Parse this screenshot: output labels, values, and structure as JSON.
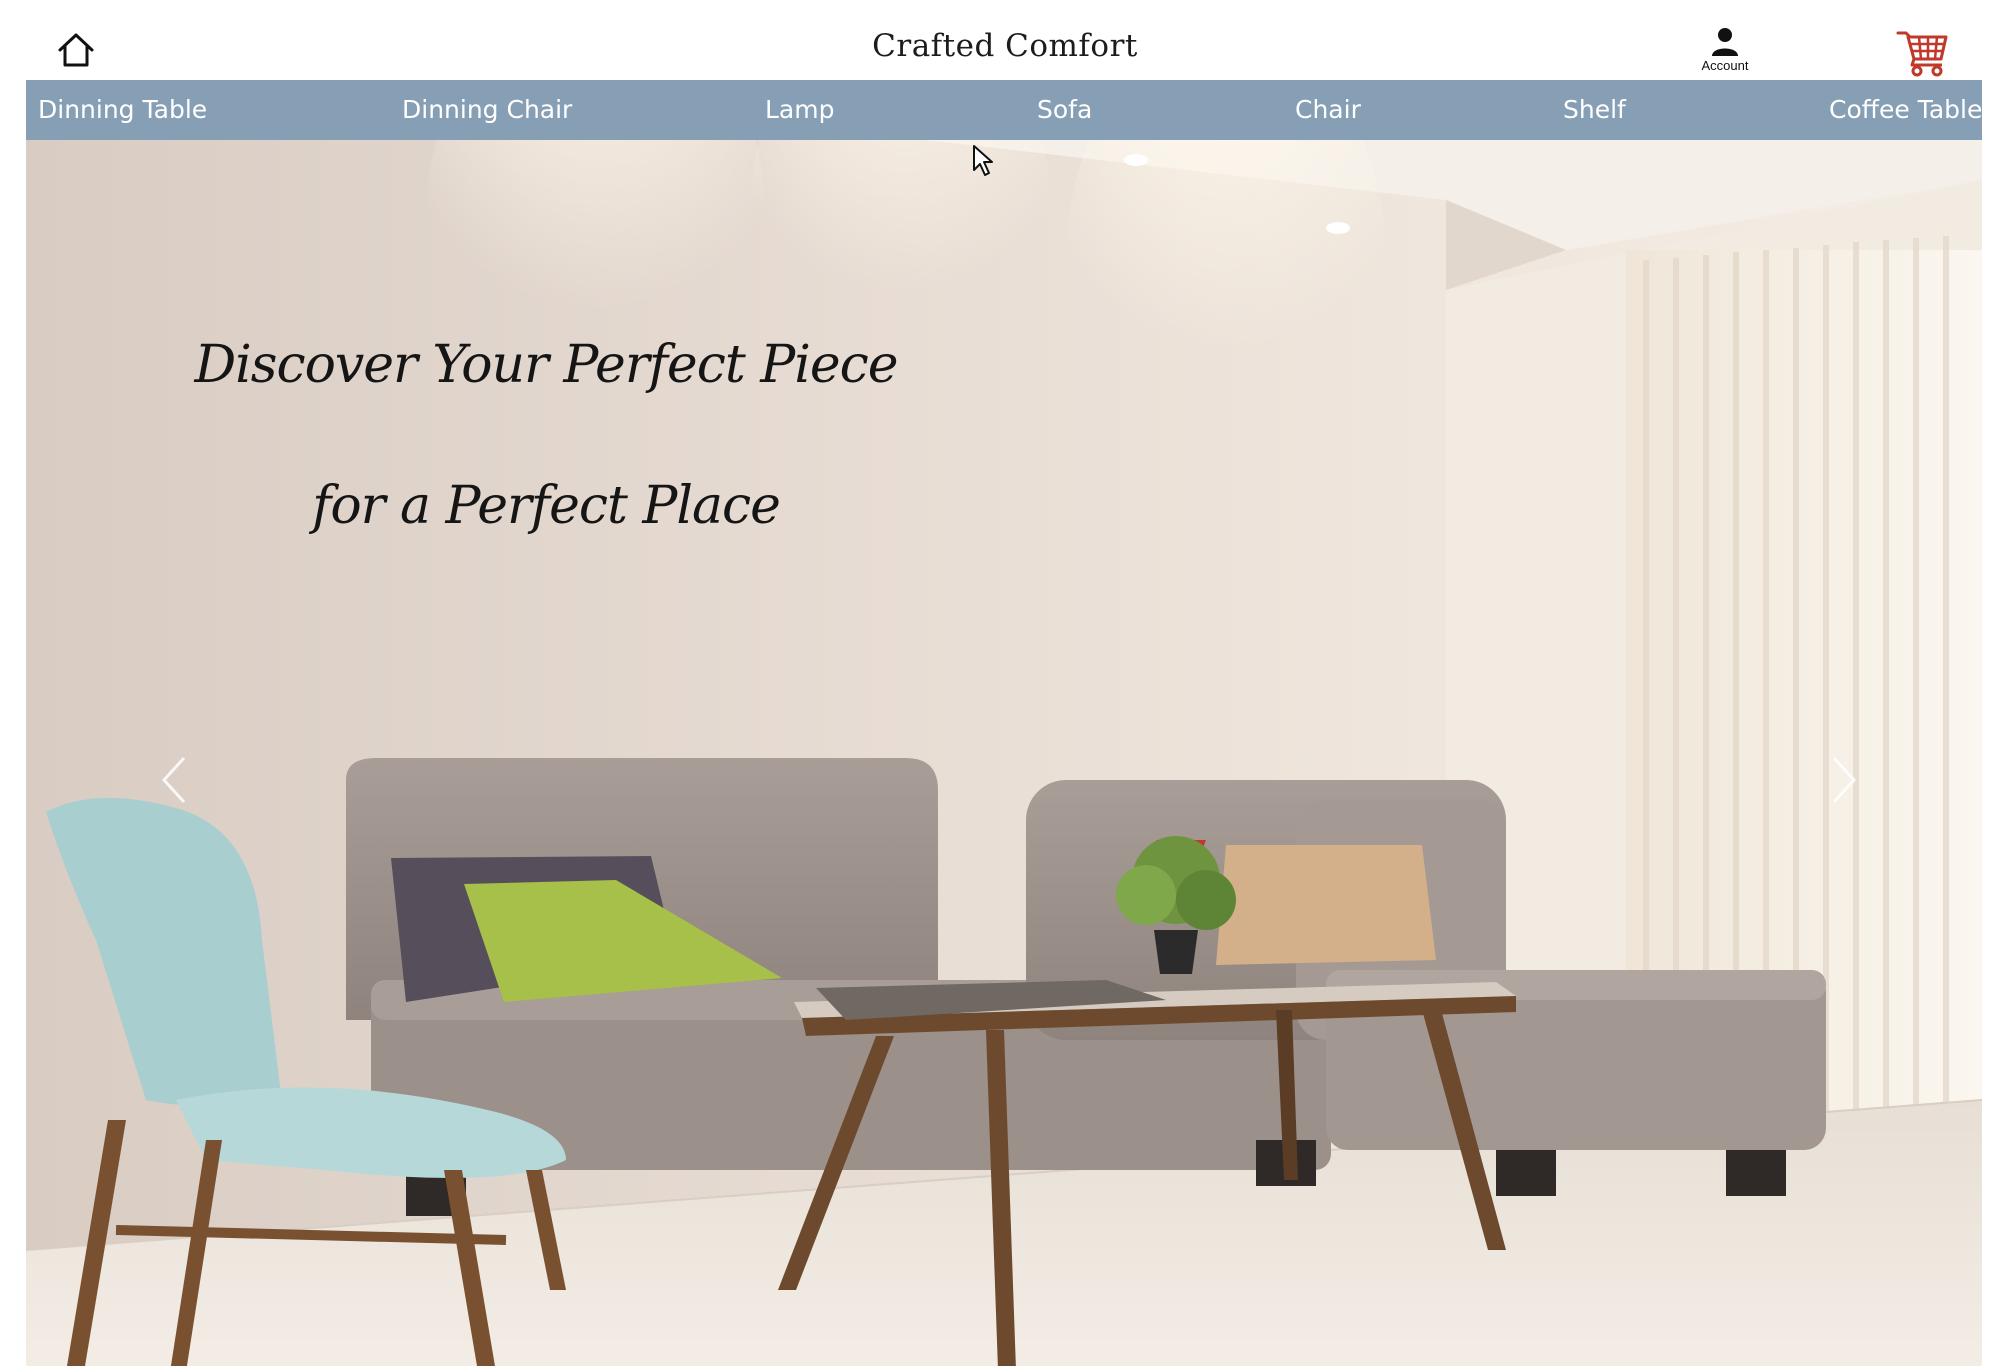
{
  "header": {
    "brand": "Crafted Comfort",
    "home_icon": "home-icon",
    "account_label": "Account",
    "account_icon": "user-icon",
    "cart_icon": "shopping-cart-icon"
  },
  "nav": {
    "background_color": "#869fb5",
    "items": [
      {
        "label": "Dinning Table"
      },
      {
        "label": "Dinning Chair"
      },
      {
        "label": "Lamp"
      },
      {
        "label": "Sofa"
      },
      {
        "label": "Chair"
      },
      {
        "label": "Shelf"
      },
      {
        "label": "Coffee Table"
      }
    ]
  },
  "hero": {
    "line1": "Discover Your Perfect Piece",
    "line2": "for a Perfect Place",
    "prev_icon": "chevron-left-icon",
    "next_icon": "chevron-right-icon"
  },
  "colors": {
    "cart_accent": "#c0392b",
    "text_dark": "#151515"
  }
}
